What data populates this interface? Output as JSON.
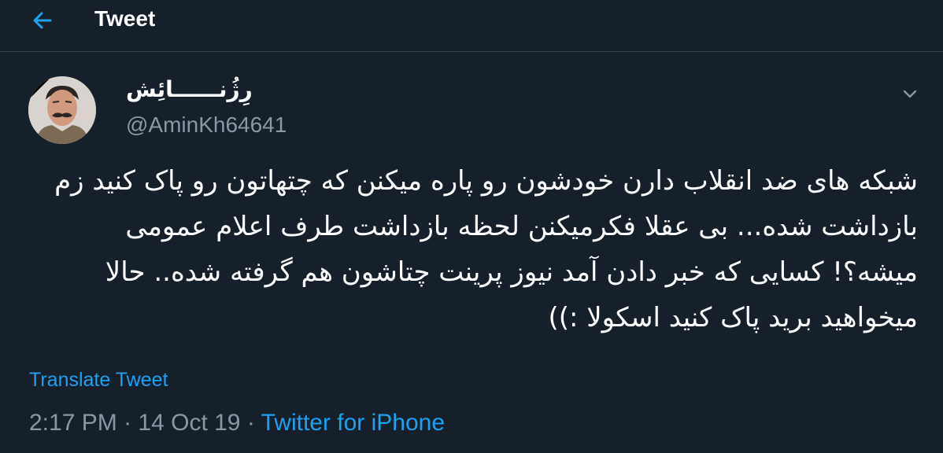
{
  "header": {
    "title": "Tweet",
    "back_icon": "arrow-left-icon"
  },
  "tweet": {
    "author": {
      "display_name": "رِژُنــــــائِش",
      "handle": "@AminKh64641"
    },
    "text": "شبکه های ضد انقلاب دارن خودشون رو پاره میکنن که چتهاتون رو پاک کنید زم بازداشت شده... بی عقلا فکرمیکنن لحظه بازداشت طرف اعلام عمومی میشه؟! کسایی که خبر دادن آمد نیوز پرینت چتاشون هم گرفته شده.. حالا میخواهید برید پاک کنید اسکولا :))",
    "translate_label": "Translate Tweet",
    "time": "2:17 PM",
    "separator": " · ",
    "date": "14 Oct 19",
    "source": "Twitter for iPhone"
  },
  "colors": {
    "background": "#15202b",
    "accent": "#1da1f2",
    "secondary_text": "#8899a6",
    "divider": "#38444d"
  }
}
